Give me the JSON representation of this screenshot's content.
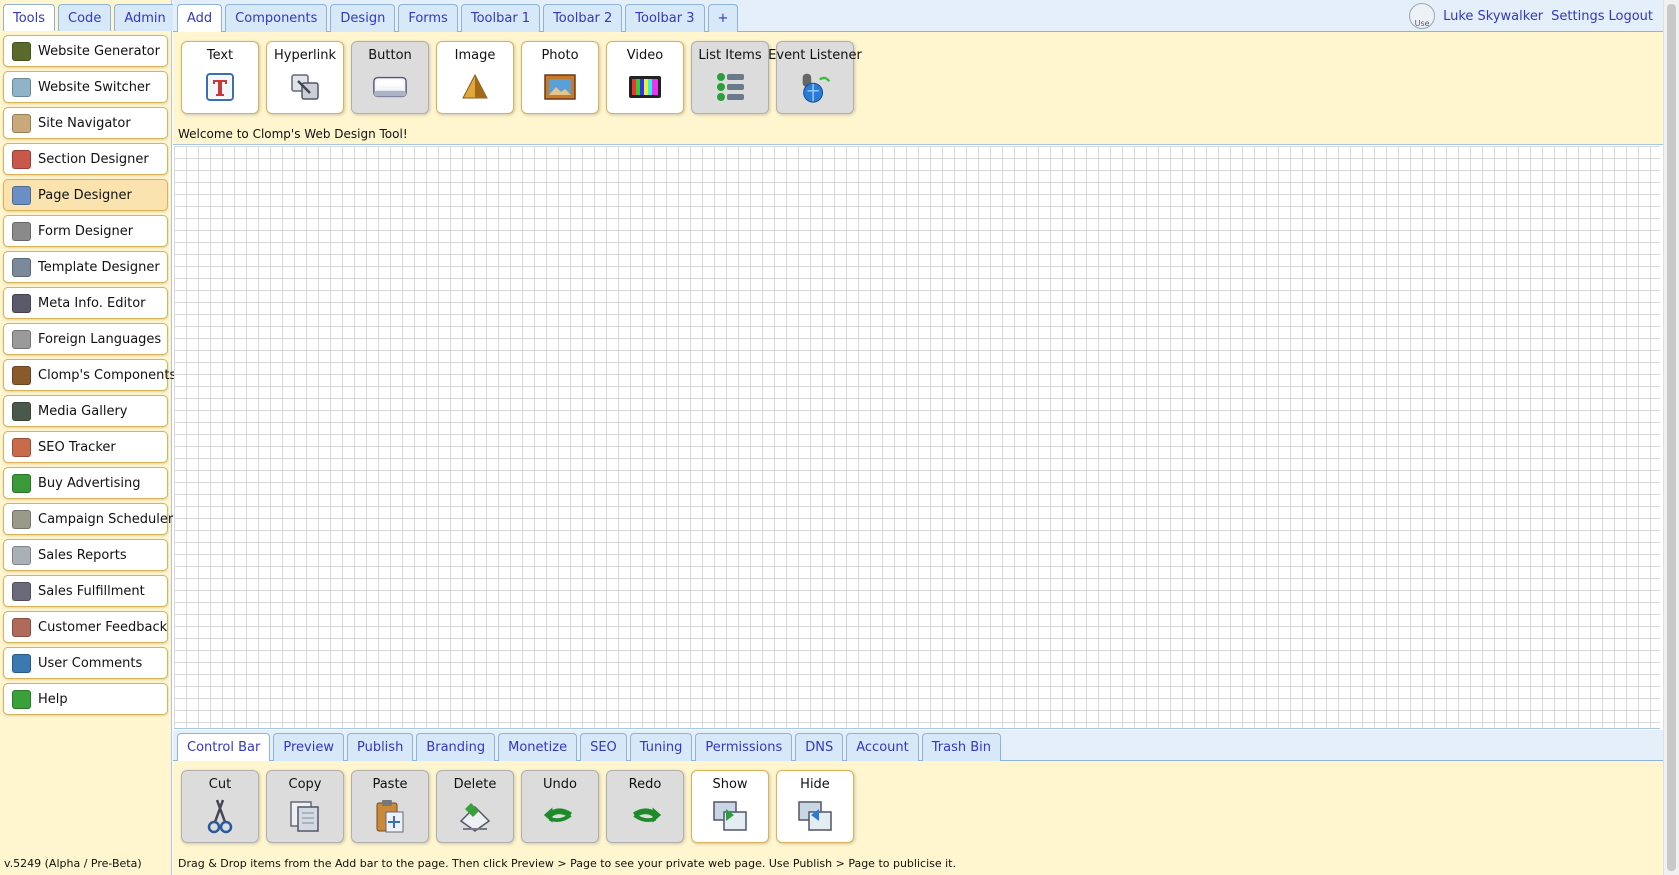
{
  "sidebar": {
    "tabs": [
      {
        "label": "Tools",
        "active": true
      },
      {
        "label": "Code",
        "active": false
      },
      {
        "label": "Admin",
        "active": false
      }
    ],
    "items": [
      {
        "label": "Website Generator",
        "icon": "website-generator-icon",
        "color": "#5a6a2a"
      },
      {
        "label": "Website Switcher",
        "icon": "website-switcher-icon",
        "color": "#8fb3c9"
      },
      {
        "label": "Site Navigator",
        "icon": "site-navigator-icon",
        "color": "#c9a97a"
      },
      {
        "label": "Section Designer",
        "icon": "section-designer-icon",
        "color": "#c9574a"
      },
      {
        "label": "Page Designer",
        "icon": "page-designer-icon",
        "color": "#6a8fc4",
        "active": true
      },
      {
        "label": "Form Designer",
        "icon": "form-designer-icon",
        "color": "#8a8a8a"
      },
      {
        "label": "Template Designer",
        "icon": "template-designer-icon",
        "color": "#7a8a9a"
      },
      {
        "label": "Meta Info. Editor",
        "icon": "meta-editor-icon",
        "color": "#5a5a6a"
      },
      {
        "label": "Foreign Languages",
        "icon": "foreign-languages-icon",
        "color": "#9a9a9a"
      },
      {
        "label": "Clomp's Components",
        "icon": "components-icon",
        "color": "#8a5a2a"
      },
      {
        "label": "Media Gallery",
        "icon": "media-gallery-icon",
        "color": "#4a5a4a"
      },
      {
        "label": "SEO Tracker",
        "icon": "seo-tracker-icon",
        "color": "#c96a4a"
      },
      {
        "label": "Buy Advertising",
        "icon": "dollar-icon",
        "color": "#3a9a3a"
      },
      {
        "label": "Campaign Scheduler",
        "icon": "campaign-scheduler-icon",
        "color": "#9a9a8a"
      },
      {
        "label": "Sales Reports",
        "icon": "sales-reports-icon",
        "color": "#aab0b8"
      },
      {
        "label": "Sales Fulfillment",
        "icon": "sales-fulfillment-icon",
        "color": "#6a6a7a"
      },
      {
        "label": "Customer Feedback",
        "icon": "customer-feedback-icon",
        "color": "#b06a5a"
      },
      {
        "label": "User Comments",
        "icon": "user-comments-icon",
        "color": "#3a7ab0"
      },
      {
        "label": "Help",
        "icon": "help-icon",
        "color": "#3aa03a"
      }
    ],
    "version": "v.5249 (Alpha / Pre-Beta)"
  },
  "header": {
    "tabs": [
      {
        "label": "Add",
        "active": true
      },
      {
        "label": "Components",
        "active": false
      },
      {
        "label": "Design",
        "active": false
      },
      {
        "label": "Forms",
        "active": false
      },
      {
        "label": "Toolbar 1",
        "active": false
      },
      {
        "label": "Toolbar 2",
        "active": false
      },
      {
        "label": "Toolbar 3",
        "active": false
      },
      {
        "label": "+",
        "active": false
      }
    ],
    "avatar_alt": "Use",
    "user_name": "Luke Skywalker",
    "settings_label": "Settings",
    "logout_label": "Logout",
    "tools": [
      {
        "label": "Text",
        "icon": "text-icon",
        "grey": false
      },
      {
        "label": "Hyperlink",
        "icon": "hyperlink-icon",
        "grey": false
      },
      {
        "label": "Button",
        "icon": "button-icon",
        "grey": true
      },
      {
        "label": "Image",
        "icon": "image-icon",
        "grey": false
      },
      {
        "label": "Photo",
        "icon": "photo-icon",
        "grey": false
      },
      {
        "label": "Video",
        "icon": "video-icon",
        "grey": false
      },
      {
        "label": "List Items",
        "icon": "list-items-icon",
        "grey": true
      },
      {
        "label": "Event Listener",
        "icon": "event-listener-icon",
        "grey": true
      }
    ],
    "welcome": "Welcome to Clomp's Web Design Tool!"
  },
  "bottom": {
    "tabs": [
      {
        "label": "Control Bar",
        "active": true
      },
      {
        "label": "Preview",
        "active": false
      },
      {
        "label": "Publish",
        "active": false
      },
      {
        "label": "Branding",
        "active": false
      },
      {
        "label": "Monetize",
        "active": false
      },
      {
        "label": "SEO",
        "active": false
      },
      {
        "label": "Tuning",
        "active": false
      },
      {
        "label": "Permissions",
        "active": false
      },
      {
        "label": "DNS",
        "active": false
      },
      {
        "label": "Account",
        "active": false
      },
      {
        "label": "Trash Bin",
        "active": false
      }
    ],
    "controls": [
      {
        "label": "Cut",
        "icon": "scissors-icon",
        "grey": true
      },
      {
        "label": "Copy",
        "icon": "copy-icon",
        "grey": true
      },
      {
        "label": "Paste",
        "icon": "paste-icon",
        "grey": true
      },
      {
        "label": "Delete",
        "icon": "delete-icon",
        "grey": true
      },
      {
        "label": "Undo",
        "icon": "undo-icon",
        "grey": true
      },
      {
        "label": "Redo",
        "icon": "redo-icon",
        "grey": true
      },
      {
        "label": "Show",
        "icon": "show-icon",
        "grey": false
      },
      {
        "label": "Hide",
        "icon": "hide-icon",
        "grey": false
      }
    ],
    "footer": "Drag & Drop items from the Add bar to the page. Then click Preview > Page to see your private web page. Use Publish > Page to publicise it."
  }
}
